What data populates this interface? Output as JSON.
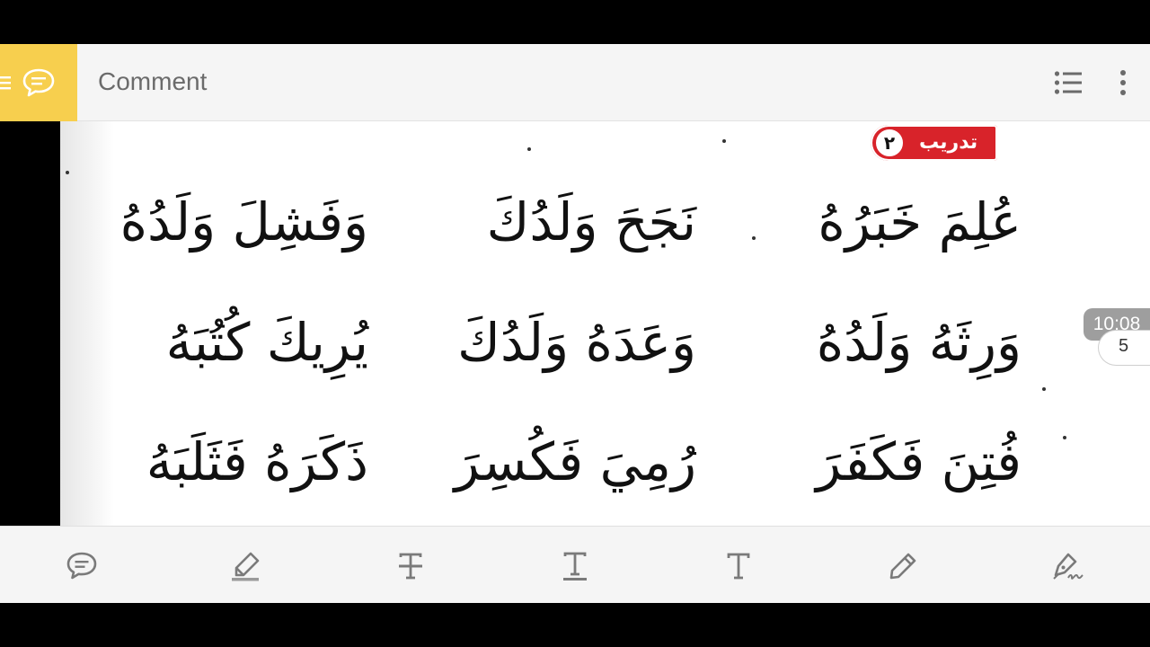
{
  "toolbar": {
    "title": "Comment",
    "mode_icon": "comment-icon",
    "list_icon": "list-icon",
    "more_icon": "more-vertical-icon"
  },
  "exercise": {
    "label": "تدريب",
    "number": "٢"
  },
  "phrases": [
    "عُلِمَ خَبَرُهُ",
    "نَجَحَ وَلَدُكَ",
    "وَفَشِلَ وَلَدُهُ",
    "وَرِثَهُ وَلَدُهُ",
    "وَعَدَهُ وَلَدُكَ",
    "يُرِيكَ كُتُبَهُ",
    "فُتِنَ فَكَفَرَ",
    "رُمِيَ فَكُسِرَ",
    "ذَكَرَهُ فَثَلَبَهُ"
  ],
  "playback": {
    "time": "10:08",
    "page": "5"
  },
  "tools": [
    "comment-icon",
    "highlighter-icon",
    "strikethrough-icon",
    "underline-icon",
    "text-icon",
    "pencil-icon",
    "signature-icon"
  ],
  "colors": {
    "accent": "#f7cf4e",
    "badge_red": "#d8232a",
    "toolbar_bg": "#f5f5f5",
    "icon_gray": "#7a7a7a"
  }
}
